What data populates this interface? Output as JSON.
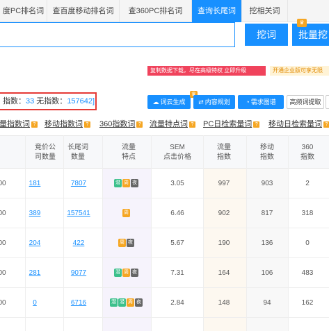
{
  "tabs": [
    {
      "label": "度PC排名词"
    },
    {
      "label": "查百度移动排名词"
    },
    {
      "label": "查360PC排名词"
    },
    {
      "label": "查询长尾词",
      "active": true
    },
    {
      "label": "挖相关词"
    }
  ],
  "search": {
    "dig_button": "挖词",
    "batch_button": "批量挖"
  },
  "promo": {
    "left": "复制数据下载，尽在高级特权 立即升级",
    "right": "开通企业版可享无限"
  },
  "counts": {
    "text_a": "指数：",
    "index_count": "33",
    "text_b": " 无指数：",
    "no_index_count": "157642]"
  },
  "tools": [
    {
      "label": "词云生成",
      "icon": "cloud-icon"
    },
    {
      "label": "内容规划",
      "icon": "share-icon"
    },
    {
      "label": "需求图谱",
      "icon": "chart-icon"
    },
    {
      "label": "高频词提取",
      "icon": ""
    },
    {
      "label": "取",
      "icon": ""
    }
  ],
  "filters": [
    "量指数词",
    "移动指数词",
    "360指数词",
    "流量特点词",
    "PC日检索量词",
    "移动日检索量词"
  ],
  "table": {
    "headers": [
      {
        "l1": "",
        "l2": ""
      },
      {
        "l1": "竞价公",
        "l2": "司数量"
      },
      {
        "l1": "长尾词",
        "l2": "数量"
      },
      {
        "l1": "流量",
        "l2": "特点"
      },
      {
        "l1": "SEM",
        "l2": "点击价格"
      },
      {
        "l1": "流量",
        "l2": "指数"
      },
      {
        "l1": "移动",
        "l2": "指数"
      },
      {
        "l1": "360",
        "l2": "指数"
      }
    ],
    "rows": [
      {
        "c0": "00",
        "bid": "181",
        "longtail": "7807",
        "tags": [
          "潜",
          "周",
          "夜"
        ],
        "sem": "3.05",
        "flow": "997",
        "mobile": "903",
        "s360": "2"
      },
      {
        "c0": "00",
        "bid": "389",
        "longtail": "157541",
        "tags": [
          "周"
        ],
        "sem": "6.46",
        "flow": "902",
        "mobile": "817",
        "s360": "318"
      },
      {
        "c0": "00",
        "bid": "204",
        "longtail": "422",
        "tags": [
          "周",
          "夜"
        ],
        "sem": "5.67",
        "flow": "190",
        "mobile": "136",
        "s360": "0"
      },
      {
        "c0": "00",
        "bid": "281",
        "longtail": "9077",
        "tags": [
          "潜",
          "周",
          "夜"
        ],
        "sem": "7.31",
        "flow": "164",
        "mobile": "106",
        "s360": "483"
      },
      {
        "c0": "00",
        "bid": "0",
        "longtail": "6716",
        "tags": [
          "潜",
          "潜",
          "周",
          "夜"
        ],
        "sem": "2.84",
        "flow": "148",
        "mobile": "94",
        "s360": "162"
      }
    ]
  },
  "colors": {
    "accent": "#1890ff",
    "green_tag": "#3cc08c",
    "orange_tag": "#f5a623",
    "gray_tag": "#666666",
    "red": "#e53935"
  }
}
